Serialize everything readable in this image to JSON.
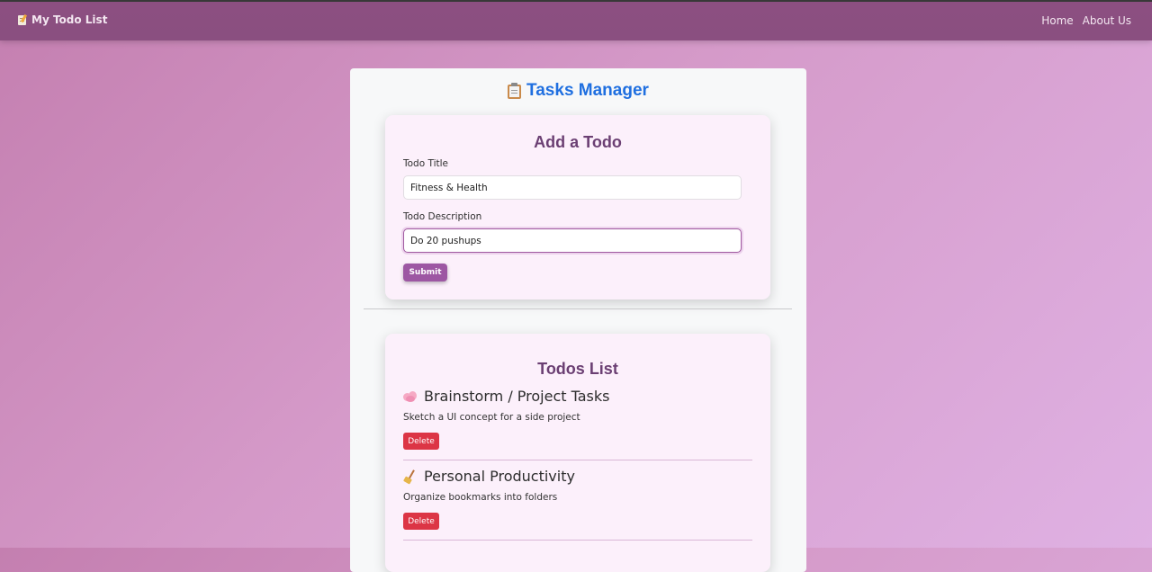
{
  "navbar": {
    "brand_label": "My Todo List",
    "brand_icon": "memo-icon",
    "links": [
      {
        "label": "Home"
      },
      {
        "label": "About Us"
      }
    ]
  },
  "page": {
    "title": "Tasks Manager",
    "title_icon": "clipboard-icon",
    "title_color": "#1f6fe0"
  },
  "add_form": {
    "heading": "Add a Todo",
    "title_label": "Todo Title",
    "title_value": "Fitness & Health",
    "description_label": "Todo Description",
    "description_value": "Do 20 pushups",
    "submit_label": "Submit",
    "accent_color": "#9d57a3"
  },
  "todos_list": {
    "heading": "Todos List",
    "delete_color": "#dc3545",
    "items": [
      {
        "icon": "brain-icon",
        "title": "Brainstorm / Project Tasks",
        "description": "Sketch a UI concept for a side project",
        "delete_label": "Delete"
      },
      {
        "icon": "broom-icon",
        "title": "Personal Productivity",
        "description": "Organize bookmarks into folders",
        "delete_label": "Delete"
      }
    ]
  }
}
